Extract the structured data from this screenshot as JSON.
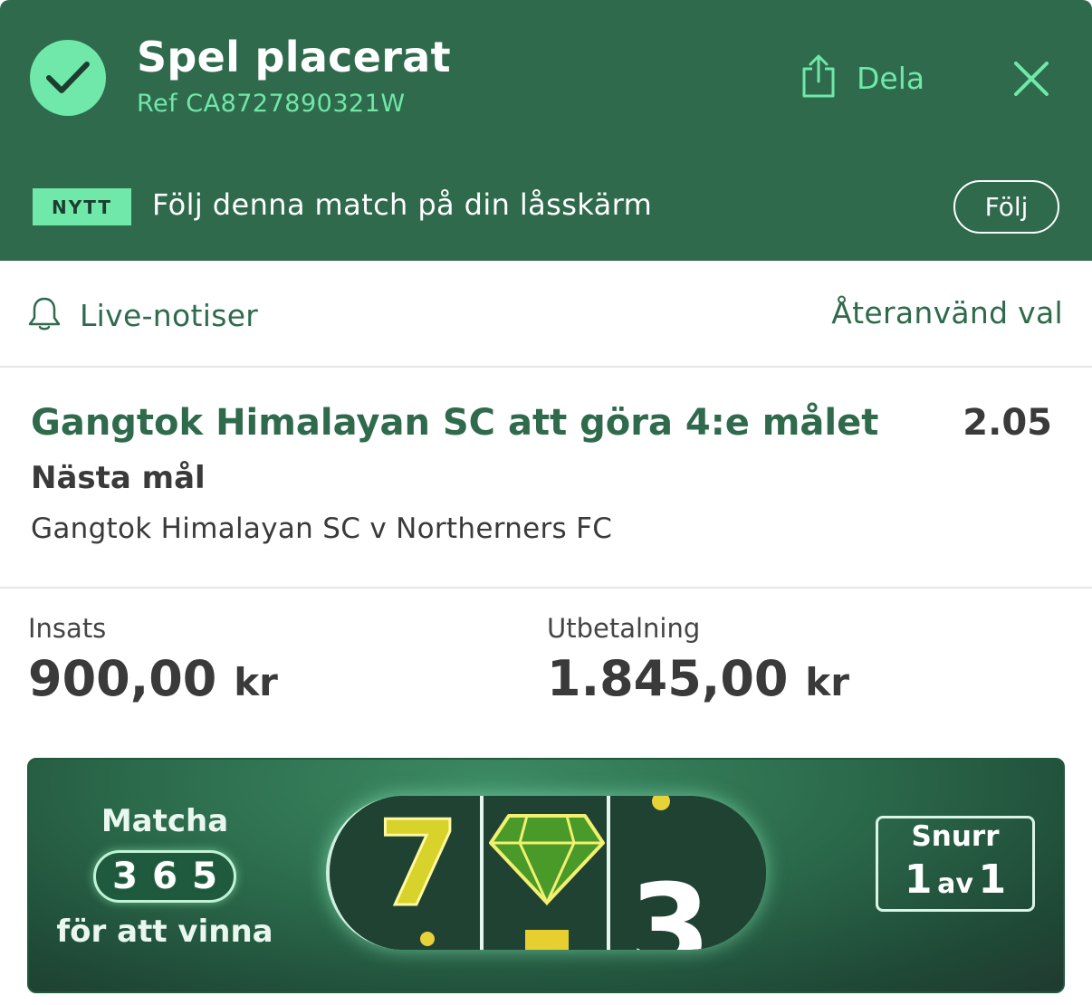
{
  "header": {
    "title": "Spel placerat",
    "ref": "Ref CA8727890321W",
    "share_label": "Dela",
    "badge": "NYTT",
    "follow_text": "Följ denna match på din låsskärm",
    "follow_button": "Följ"
  },
  "actions": {
    "live_label": "Live-notiser",
    "reuse_label": "Återanvänd val"
  },
  "selection": {
    "name": "Gangtok Himalayan SC att göra 4:e målet",
    "odds": "2.05",
    "market": "Nästa mål",
    "event": "Gangtok Himalayan SC v Northerners FC"
  },
  "stake": {
    "stake_label": "Insats",
    "stake_amount": "900,00",
    "stake_currency": "kr",
    "payout_label": "Utbetalning",
    "payout_amount": "1.845,00",
    "payout_currency": "kr"
  },
  "promo": {
    "title": "Matcha",
    "digits": [
      "3",
      "6",
      "5"
    ],
    "subtitle": "för att vinna",
    "reels": [
      "7",
      "diamond",
      "3"
    ],
    "spin_label": "Snurr",
    "spin_current": "1",
    "spin_of": "av",
    "spin_total": "1"
  },
  "colors": {
    "brand_green": "#2f6a4c",
    "accent_mint": "#6fe8a9"
  }
}
